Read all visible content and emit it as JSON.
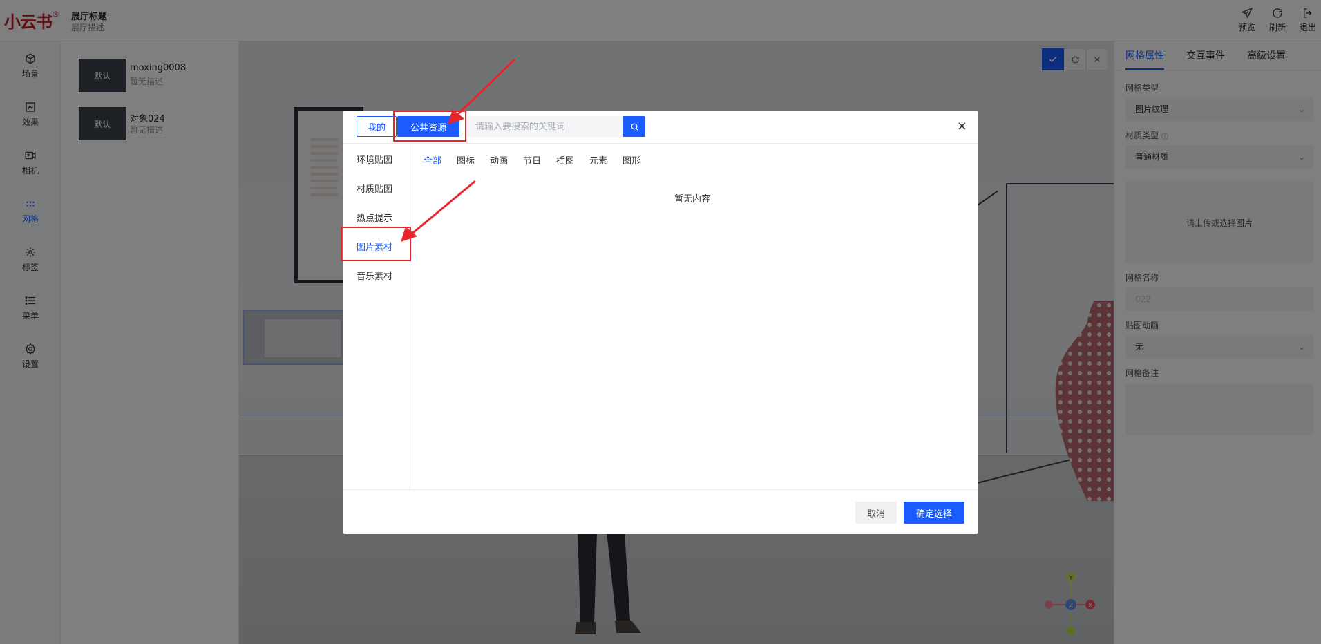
{
  "app": {
    "logo": "小云书",
    "logo_mark": "®",
    "hall_title": "展厅标题",
    "hall_desc": "展厅描述"
  },
  "top_actions": [
    {
      "label": "预览",
      "icon": "send-icon"
    },
    {
      "label": "刷新",
      "icon": "refresh-icon"
    },
    {
      "label": "退出",
      "icon": "logout-icon"
    }
  ],
  "nav": [
    {
      "label": "场景",
      "icon": "cube-icon"
    },
    {
      "label": "效果",
      "icon": "effect-icon"
    },
    {
      "label": "相机",
      "icon": "camera-icon"
    },
    {
      "label": "网格",
      "icon": "grid-icon",
      "active": true
    },
    {
      "label": "标签",
      "icon": "tag-icon"
    },
    {
      "label": "菜单",
      "icon": "menu-icon"
    },
    {
      "label": "设置",
      "icon": "gear-icon"
    }
  ],
  "objects": [
    {
      "thumb": "默认",
      "name": "moxing0008",
      "desc": "暂无描述"
    },
    {
      "thumb": "默认",
      "name": "对象024",
      "desc": "暂无描述"
    }
  ],
  "viewport_toolbar": [
    "check-icon",
    "refresh-icon",
    "close-icon"
  ],
  "gizmo": {
    "y": "Y",
    "z": "Z",
    "x": "X"
  },
  "right_panel": {
    "tabs": [
      "网格属性",
      "交互事件",
      "高级设置"
    ],
    "mesh_type_label": "网格类型",
    "mesh_type_value": "图片纹理",
    "material_type_label": "材质类型",
    "material_type_value": "普通材质",
    "upload_hint": "请上传或选择图片",
    "mesh_name_label": "网格名称",
    "mesh_name_placeholder": "022",
    "map_anim_label": "贴图动画",
    "map_anim_value": "无",
    "mesh_note_label": "网格备注"
  },
  "modal": {
    "tab_mine": "我的",
    "tab_public": "公共资源",
    "search_placeholder": "请输入要搜索的关键词",
    "categories": [
      "环境贴图",
      "材质贴图",
      "热点提示",
      "图片素材",
      "音乐素材"
    ],
    "active_category": "图片素材",
    "filters": [
      "全部",
      "图标",
      "动画",
      "节日",
      "插图",
      "元素",
      "图形"
    ],
    "active_filter": "全部",
    "empty_text": "暂无内容",
    "cancel": "取消",
    "confirm": "确定选择"
  },
  "colors": {
    "primary": "#1a5cff",
    "annotation": "#e8262a",
    "logo": "#c81e2a"
  }
}
